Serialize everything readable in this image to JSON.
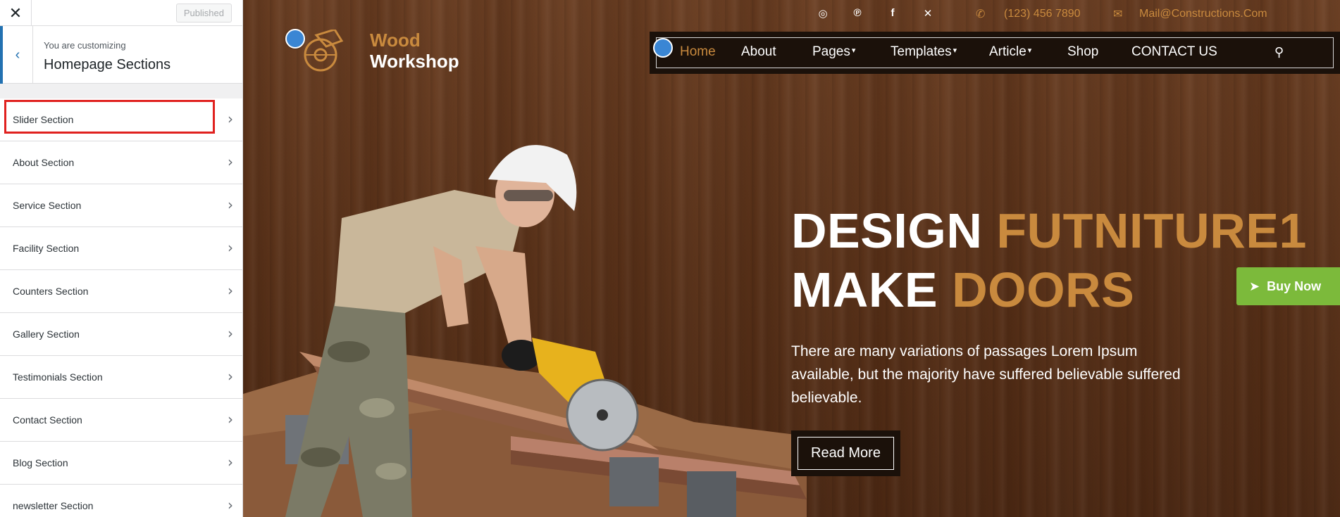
{
  "customizer": {
    "close_icon": "close-icon",
    "published_label": "Published",
    "back_icon": "chevron-left-icon",
    "info_small": "You are customizing",
    "info_title": "Homepage Sections",
    "sections": [
      {
        "label": "Slider Section",
        "active": true
      },
      {
        "label": "About Section"
      },
      {
        "label": "Service Section"
      },
      {
        "label": "Facility Section"
      },
      {
        "label": "Counters Section"
      },
      {
        "label": "Gallery Section"
      },
      {
        "label": "Testimonials Section"
      },
      {
        "label": "Contact Section"
      },
      {
        "label": "Blog Section"
      },
      {
        "label": "newsletter Section"
      }
    ],
    "chevron_glyph": "›"
  },
  "site": {
    "logo": {
      "word1": "Wood",
      "word2": "Workshop",
      "icon": "circular-saw-icon"
    },
    "social_icons": [
      "instagram-icon",
      "pinterest-icon",
      "facebook-icon",
      "x-icon"
    ],
    "phone": "(123) 456 7890",
    "email": "Mail@Constructions.Com",
    "nav": [
      {
        "label": "Home",
        "active": true
      },
      {
        "label": "About"
      },
      {
        "label": "Pages",
        "dropdown": true
      },
      {
        "label": "Templates",
        "dropdown": true
      },
      {
        "label": "Article",
        "dropdown": true
      },
      {
        "label": "Shop"
      },
      {
        "label": "CONTACT US"
      }
    ],
    "hero": {
      "line1_white": "DESIGN ",
      "line1_orange": "FUTNITURE1",
      "line2_white": "MAKE ",
      "line2_orange": "DOORS",
      "paragraph": "There are many variations of passages Lorem Ipsum available, but the majority have suffered believable suffered believable.",
      "button": "Read More"
    },
    "buy_now": "Buy Now"
  },
  "colors": {
    "accent": "#c98a3e",
    "buy_now_green": "#7cba3b",
    "highlight_red": "#e0211f",
    "wp_blue": "#2271b1"
  }
}
